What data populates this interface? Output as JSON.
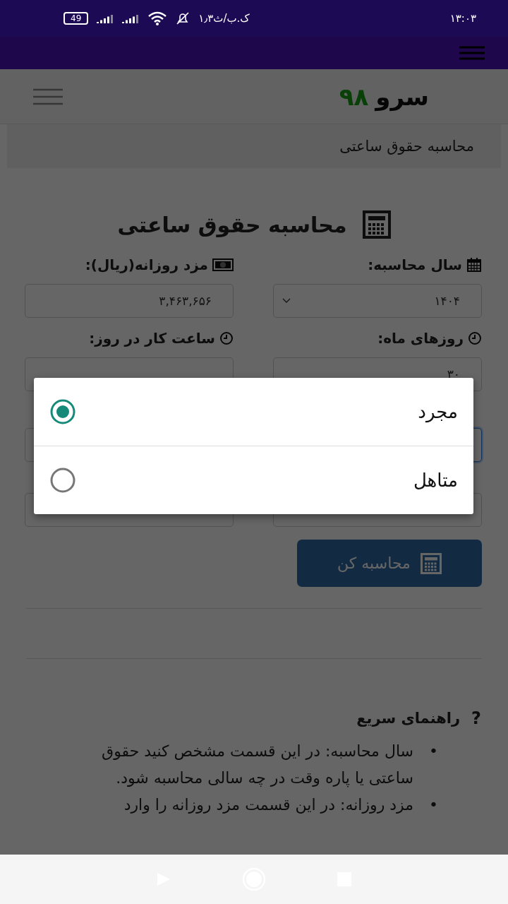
{
  "status_bar": {
    "time": "۱۳:۰۳",
    "speed": "۱٫۳ک.ب/ث",
    "battery": "49"
  },
  "site": {
    "logo_name": "سرو",
    "logo_number": "۹۸",
    "breadcrumb": "محاسبه حقوق ساعتی"
  },
  "form": {
    "title": "محاسبه حقوق ساعتی",
    "fields": [
      {
        "label": "سال محاسبه:",
        "kind": "select",
        "value": "۱۴۰۴",
        "focused": false
      },
      {
        "label": "مزد روزانه(ریال):",
        "kind": "input",
        "value": "۳,۴۶۳,۶۵۶",
        "focused": false
      },
      {
        "label": "روزهای ماه:",
        "kind": "input",
        "value": "۳۰",
        "focused": false
      },
      {
        "label": "ساعت کار در روز:",
        "kind": "input",
        "focused": false
      },
      {
        "kind": "input",
        "focused": true
      },
      {
        "kind": "input",
        "focused": false
      },
      {
        "kind": "input",
        "focused": false
      },
      {
        "kind": "input",
        "focused": false
      }
    ],
    "submit": "محاسبه کن"
  },
  "help": {
    "mark": "?",
    "title": "راهنمای سریع",
    "items": [
      {
        "bullet": "•",
        "text": "سال محاسبه: در این قسمت مشخص کنید حقوق ساعتی یا پاره وقت در چه سالی محاسبه شود."
      },
      {
        "bullet": "•",
        "text": "مزد روزانه: در این قسمت مزد روزانه را وارد"
      }
    ]
  },
  "dialog": {
    "options": [
      {
        "label": "مجرد",
        "selected": true
      },
      {
        "label": "متاهل",
        "selected": false
      }
    ]
  }
}
